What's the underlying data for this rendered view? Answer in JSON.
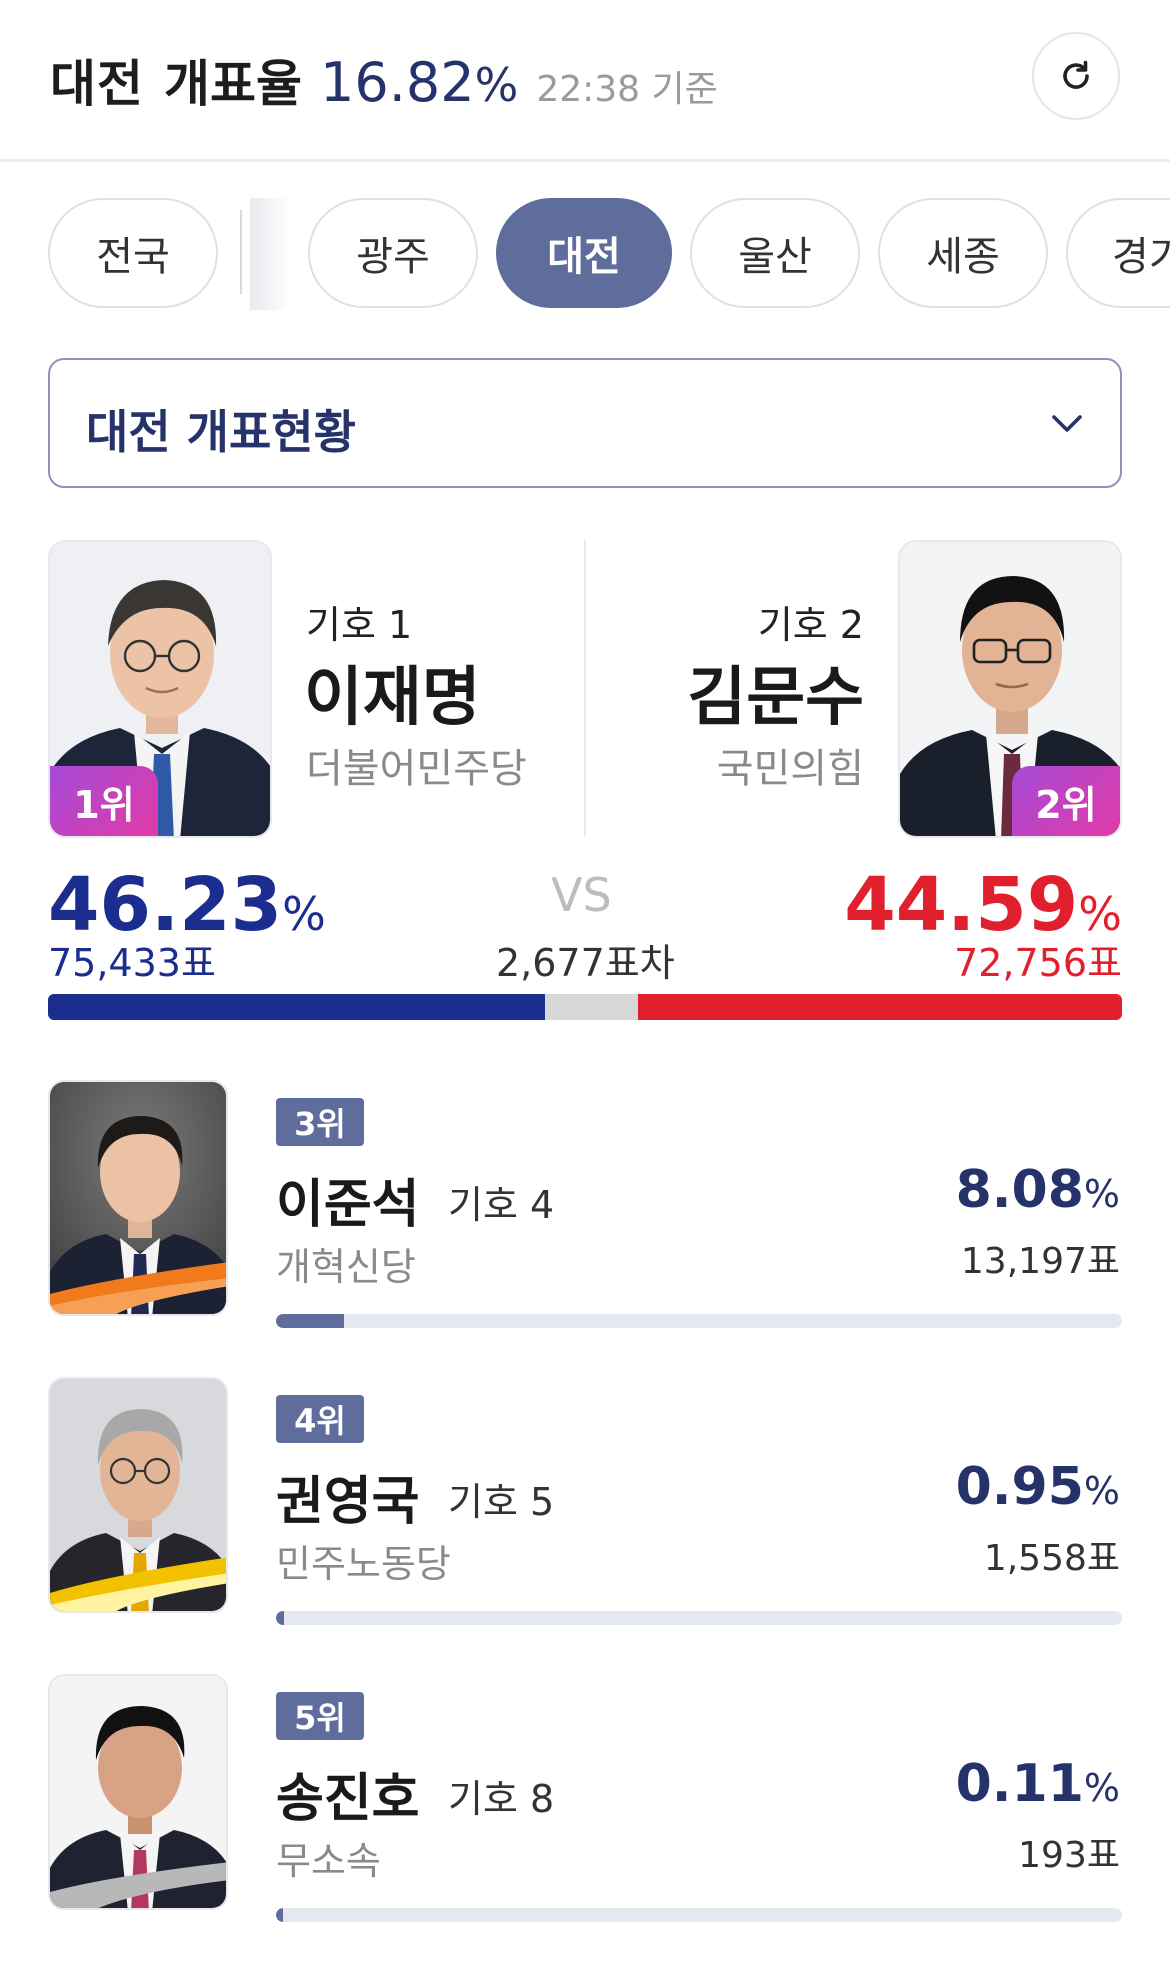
{
  "header": {
    "region": "대전",
    "label": "개표율",
    "rate": "16.82",
    "pct": "%",
    "time": "22:38 기준"
  },
  "tabs": [
    {
      "label": "전국",
      "active": false
    },
    {
      "label": "광주",
      "active": false
    },
    {
      "label": "대전",
      "active": true
    },
    {
      "label": "울산",
      "active": false
    },
    {
      "label": "세종",
      "active": false
    },
    {
      "label": "경기",
      "active": false
    }
  ],
  "dropdown": {
    "label": "대전 개표현황"
  },
  "top": {
    "first": {
      "number": "기호 1",
      "name": "이재명",
      "party": "더불어민주당",
      "rank": "1위",
      "pct": "46.23",
      "votes": "75,433표",
      "share": 46.23,
      "color": "#1b2d8e"
    },
    "second": {
      "number": "기호 2",
      "name": "김문수",
      "party": "국민의힘",
      "rank": "2위",
      "pct": "44.59",
      "votes": "72,756표",
      "share": 44.59,
      "color": "#e21f2d"
    },
    "vs": "VS",
    "diff": "2,677표차",
    "pct_symbol": "%"
  },
  "others": [
    {
      "rank": "3위",
      "name": "이준석",
      "number": "기호 4",
      "party": "개혁신당",
      "pct": "8.08",
      "votes": "13,197표",
      "share": 8.08,
      "accent": "#f07a1c"
    },
    {
      "rank": "4위",
      "name": "권영국",
      "number": "기호 5",
      "party": "민주노동당",
      "pct": "0.95",
      "votes": "1,558표",
      "share": 0.95,
      "accent": "#f2c200"
    },
    {
      "rank": "5위",
      "name": "송진호",
      "number": "기호 8",
      "party": "무소속",
      "pct": "0.11",
      "votes": "193표",
      "share": 0.11,
      "accent": "#aaaaaa"
    }
  ]
}
